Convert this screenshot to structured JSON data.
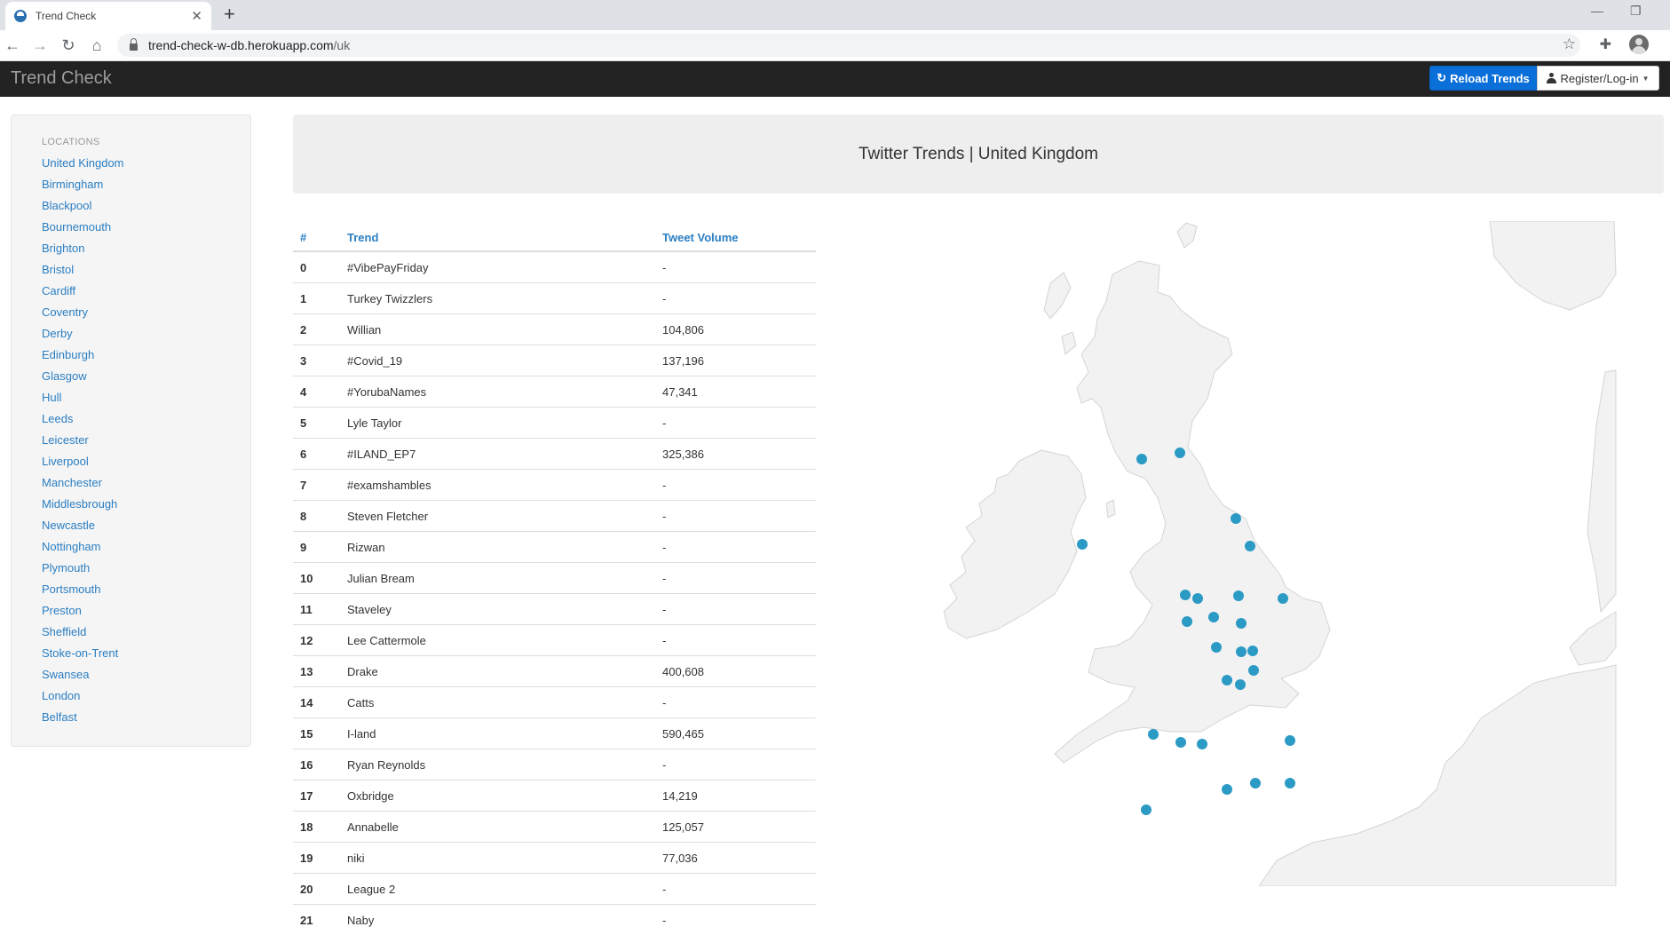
{
  "browser": {
    "tab_title": "Trend Check",
    "url_host": "trend-check-w-db.herokuapp.com",
    "url_path": "/uk"
  },
  "navbar": {
    "brand": "Trend Check",
    "reload_label": "Reload Trends",
    "login_label": "Register/Log-in"
  },
  "sidebar": {
    "header": "Locations",
    "locations": [
      "United Kingdom",
      "Birmingham",
      "Blackpool",
      "Bournemouth",
      "Brighton",
      "Bristol",
      "Cardiff",
      "Coventry",
      "Derby",
      "Edinburgh",
      "Glasgow",
      "Hull",
      "Leeds",
      "Leicester",
      "Liverpool",
      "Manchester",
      "Middlesbrough",
      "Newcastle",
      "Nottingham",
      "Plymouth",
      "Portsmouth",
      "Preston",
      "Sheffield",
      "Stoke-on-Trent",
      "Swansea",
      "London",
      "Belfast"
    ]
  },
  "page_title": "Twitter Trends | United Kingdom",
  "table": {
    "headers": [
      "#",
      "Trend",
      "Tweet Volume"
    ],
    "rows": [
      [
        "0",
        "#VibePayFriday",
        "-"
      ],
      [
        "1",
        "Turkey Twizzlers",
        "-"
      ],
      [
        "2",
        "Willian",
        "104,806"
      ],
      [
        "3",
        "#Covid_19",
        "137,196"
      ],
      [
        "4",
        "#YorubaNames",
        "47,341"
      ],
      [
        "5",
        "Lyle Taylor",
        "-"
      ],
      [
        "6",
        "#ILAND_EP7",
        "325,386"
      ],
      [
        "7",
        "#examshambles",
        "-"
      ],
      [
        "8",
        "Steven Fletcher",
        "-"
      ],
      [
        "9",
        "Rizwan",
        "-"
      ],
      [
        "10",
        "Julian Bream",
        "-"
      ],
      [
        "11",
        "Staveley",
        "-"
      ],
      [
        "12",
        "Lee Cattermole",
        "-"
      ],
      [
        "13",
        "Drake",
        "400,608"
      ],
      [
        "14",
        "Catts",
        "-"
      ],
      [
        "15",
        "I-land",
        "590,465"
      ],
      [
        "16",
        "Ryan Reynolds",
        "-"
      ],
      [
        "17",
        "Oxbridge",
        "14,219"
      ],
      [
        "18",
        "Annabelle",
        "125,057"
      ],
      [
        "19",
        "niki",
        "77,036"
      ],
      [
        "20",
        "League 2",
        "-"
      ],
      [
        "21",
        "Naby",
        "-"
      ]
    ]
  },
  "map": {
    "marker_color": "#2b9ac4",
    "land_color": "#f2f2f2",
    "border_color": "#d4d4d4",
    "markers": [
      "Glasgow",
      "Edinburgh",
      "Newcastle",
      "Middlesbrough",
      "Belfast",
      "Preston",
      "Blackpool",
      "Leeds",
      "Hull",
      "Liverpool",
      "Manchester",
      "Sheffield",
      "Stoke-on-Trent",
      "Nottingham",
      "Derby",
      "Leicester",
      "Birmingham",
      "Coventry",
      "Swansea",
      "Cardiff",
      "Bristol",
      "London",
      "Bournemouth",
      "Portsmouth",
      "Brighton",
      "Plymouth"
    ]
  }
}
